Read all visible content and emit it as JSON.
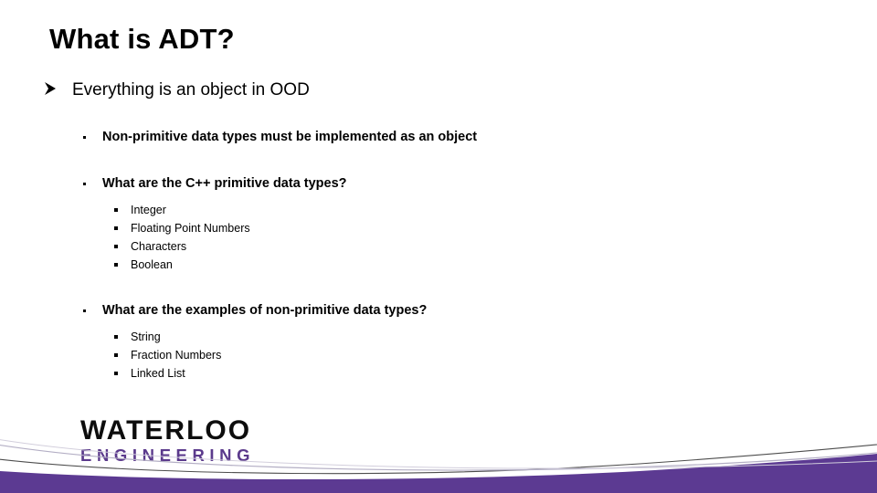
{
  "slide": {
    "title": "What is ADT?",
    "outline": [
      {
        "level": 1,
        "bullet": "arrow-bullet-icon",
        "text": "Everything is an object in OOD"
      },
      {
        "level": 2,
        "bullet": "dot-bullet-icon",
        "text": "Non-primitive data types must be implemented as an object"
      },
      {
        "level": 2,
        "bullet": "dot-bullet-icon",
        "text": "What are the C++ primitive data types?"
      },
      {
        "level": 3,
        "bullet": "square-bullet-icon",
        "text": "Integer"
      },
      {
        "level": 3,
        "bullet": "square-bullet-icon",
        "text": "Floating Point Numbers"
      },
      {
        "level": 3,
        "bullet": "square-bullet-icon",
        "text": "Characters"
      },
      {
        "level": 3,
        "bullet": "square-bullet-icon",
        "text": "Boolean"
      },
      {
        "level": 2,
        "bullet": "dot-bullet-icon",
        "text": "What are the examples of non-primitive data types?"
      },
      {
        "level": 3,
        "bullet": "square-bullet-icon",
        "text": "String"
      },
      {
        "level": 3,
        "bullet": "square-bullet-icon",
        "text": "Fraction Numbers"
      },
      {
        "level": 3,
        "bullet": "square-bullet-icon",
        "text": "Linked List"
      }
    ]
  },
  "logo": {
    "line1": "WATERLOO",
    "line2": "ENGINEERING"
  },
  "colors": {
    "brand_purple": "#5b3a8c",
    "swoosh_purple": "#5c3a92",
    "text_black": "#000000",
    "curve_dark": "#4d4d4d",
    "curve_light": "#b3aec4",
    "background": "#ffffff"
  }
}
